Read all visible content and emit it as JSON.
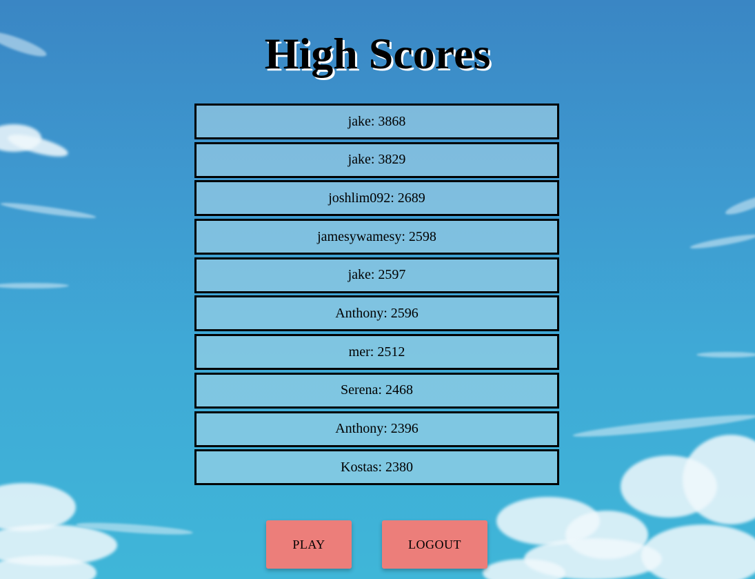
{
  "title": "High Scores",
  "scores": [
    {
      "text": "jake: 3868"
    },
    {
      "text": "jake: 3829"
    },
    {
      "text": "joshlim092: 2689"
    },
    {
      "text": "jamesywamesy: 2598"
    },
    {
      "text": "jake: 2597"
    },
    {
      "text": "Anthony: 2596"
    },
    {
      "text": "mer: 2512"
    },
    {
      "text": "Serena: 2468"
    },
    {
      "text": "Anthony: 2396"
    },
    {
      "text": "Kostas: 2380"
    }
  ],
  "buttons": {
    "play": "PLAY",
    "logout": "LOGOUT"
  },
  "colors": {
    "button": "#ec7e7a",
    "row_border": "#000000",
    "sky_top": "#3a86c4",
    "sky_bottom": "#3fb6d8"
  }
}
